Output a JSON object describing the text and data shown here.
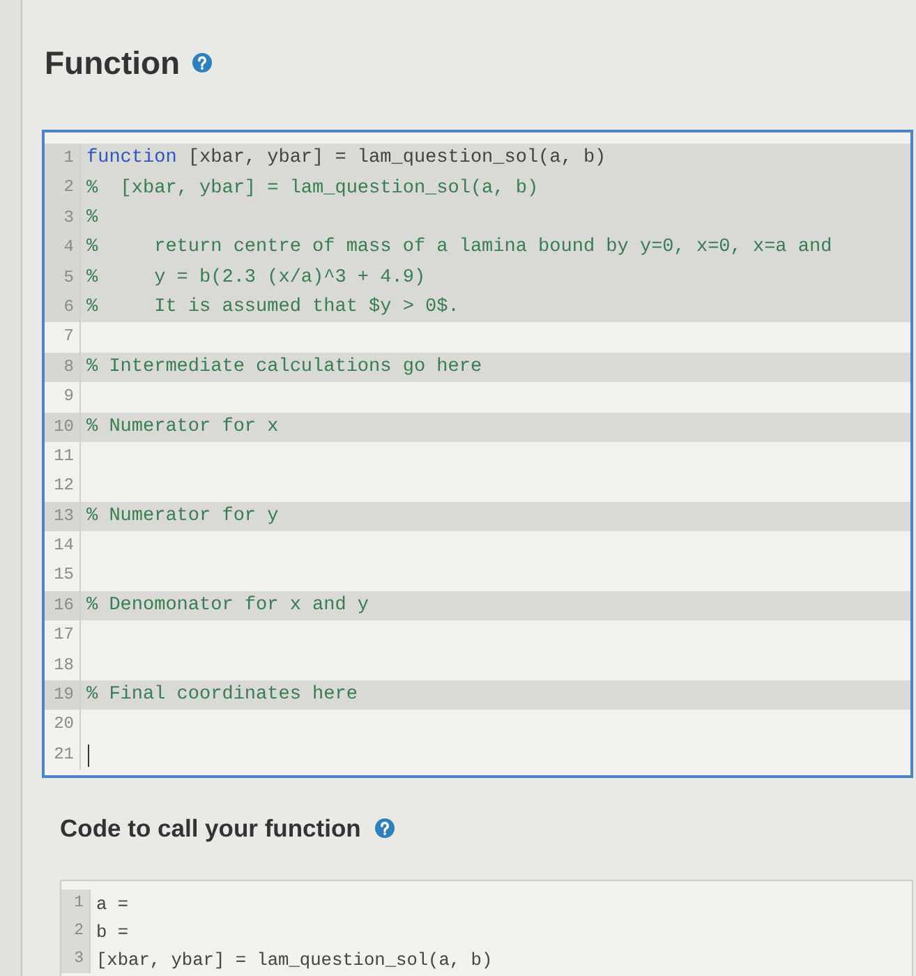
{
  "sections": [
    {
      "kind": "function",
      "title": "Function",
      "editor": {
        "focused": true,
        "lines": [
          {
            "number": "1",
            "locked": true,
            "cursor": false,
            "tokens": [
              {
                "kind": "keyword",
                "text": "function"
              },
              {
                "kind": "code",
                "text": " [xbar, ybar] = lam_question_sol(a, b)"
              }
            ]
          },
          {
            "number": "2",
            "locked": true,
            "cursor": false,
            "tokens": [
              {
                "kind": "comment",
                "text": "%  [xbar, ybar] = lam_question_sol(a, b)"
              }
            ]
          },
          {
            "number": "3",
            "locked": true,
            "cursor": false,
            "tokens": [
              {
                "kind": "comment",
                "text": "%"
              }
            ]
          },
          {
            "number": "4",
            "locked": true,
            "cursor": false,
            "tokens": [
              {
                "kind": "comment",
                "text": "%     return centre of mass of a lamina bound by y=0, x=0, x=a and"
              }
            ]
          },
          {
            "number": "5",
            "locked": true,
            "cursor": false,
            "tokens": [
              {
                "kind": "comment",
                "text": "%     y = b(2.3 (x/a)^3 + 4.9)"
              }
            ]
          },
          {
            "number": "6",
            "locked": true,
            "cursor": false,
            "tokens": [
              {
                "kind": "comment",
                "text": "%     It is assumed that $y > 0$."
              }
            ]
          },
          {
            "number": "7",
            "locked": false,
            "cursor": false
          },
          {
            "number": "8",
            "locked": true,
            "cursor": false,
            "tokens": [
              {
                "kind": "comment",
                "text": "% Intermediate calculations go here"
              }
            ]
          },
          {
            "number": "9",
            "locked": false,
            "cursor": false
          },
          {
            "number": "10",
            "locked": true,
            "cursor": false,
            "tokens": [
              {
                "kind": "comment",
                "text": "% Numerator for x"
              }
            ]
          },
          {
            "number": "11",
            "locked": false,
            "cursor": false
          },
          {
            "number": "12",
            "locked": false,
            "cursor": false
          },
          {
            "number": "13",
            "locked": true,
            "cursor": false,
            "tokens": [
              {
                "kind": "comment",
                "text": "% Numerator for y"
              }
            ]
          },
          {
            "number": "14",
            "locked": false,
            "cursor": false
          },
          {
            "number": "15",
            "locked": false,
            "cursor": false
          },
          {
            "number": "16",
            "locked": true,
            "cursor": false,
            "tokens": [
              {
                "kind": "comment",
                "text": "% Denomonator for x and y"
              }
            ]
          },
          {
            "number": "17",
            "locked": false,
            "cursor": false
          },
          {
            "number": "18",
            "locked": false,
            "cursor": false
          },
          {
            "number": "19",
            "locked": true,
            "cursor": false,
            "tokens": [
              {
                "kind": "comment",
                "text": "% Final coordinates here"
              }
            ]
          },
          {
            "number": "20",
            "locked": false,
            "cursor": false
          },
          {
            "number": "21",
            "locked": false,
            "cursor": true
          }
        ]
      }
    },
    {
      "kind": "call",
      "title": "Code to call your function",
      "editor": {
        "focused": false,
        "lines": [
          {
            "number": "1",
            "locked": false,
            "cursor": false,
            "tokens": [
              {
                "kind": "code",
                "text": "a ="
              }
            ]
          },
          {
            "number": "2",
            "locked": false,
            "cursor": false,
            "tokens": [
              {
                "kind": "code",
                "text": "b ="
              }
            ]
          },
          {
            "number": "3",
            "locked": false,
            "cursor": false,
            "tokens": [
              {
                "kind": "code",
                "text": "[xbar, ybar] = lam_question_sol(a, b)"
              }
            ]
          }
        ]
      }
    }
  ]
}
